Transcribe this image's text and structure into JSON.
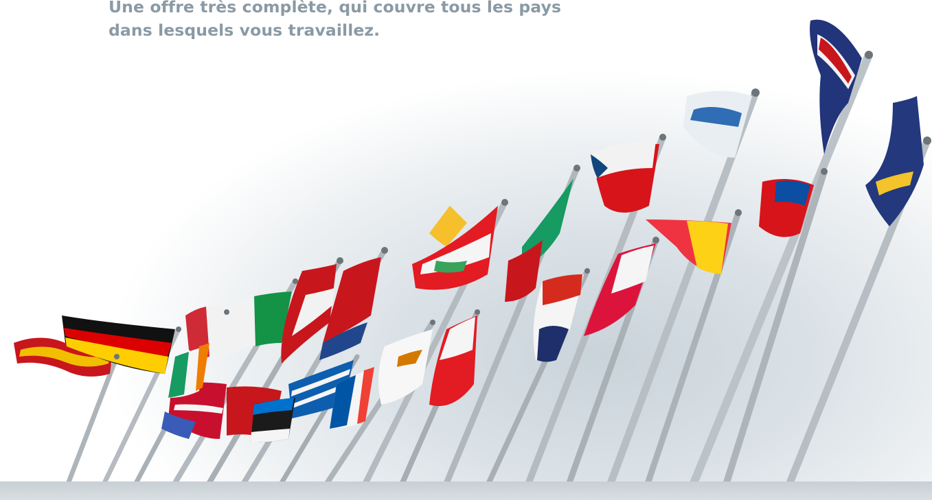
{
  "headline": {
    "line1": "Une offre très complète, qui couvre tous les pays",
    "line2": "dans lesquels vous travaillez."
  },
  "photo": {
    "subject": "flags-on-poles"
  },
  "colors": {
    "headline_text": "#8a9aa5",
    "sky": "#dbe2e7",
    "pole": "#b8bec3"
  }
}
